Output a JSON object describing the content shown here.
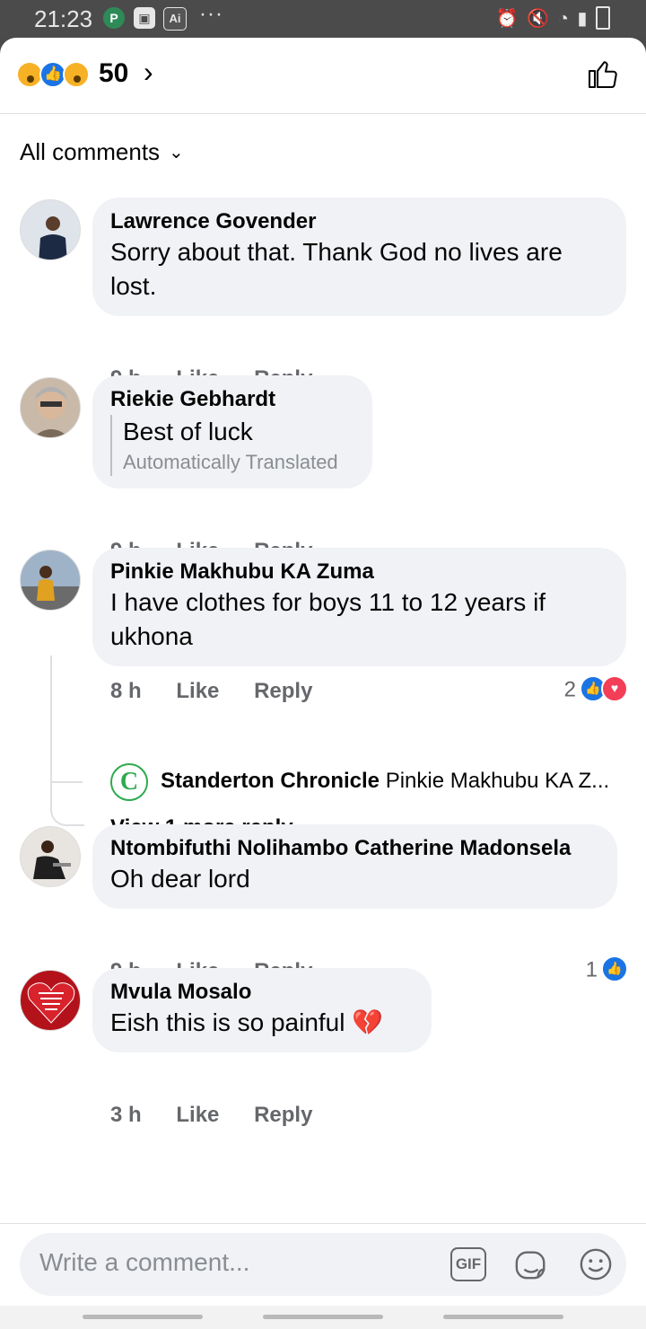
{
  "status": {
    "time": "21:23",
    "icons": [
      "p-icon",
      "image-icon",
      "ai-icon",
      "alarm-icon",
      "mute-icon",
      "wifi-icon",
      "signal-icon",
      "battery-icon"
    ],
    "battery": "7"
  },
  "header": {
    "reaction_count": "50",
    "reactions": [
      "sad",
      "like",
      "wow"
    ]
  },
  "sort": {
    "label": "All comments"
  },
  "comments": [
    {
      "author": "Lawrence Govender",
      "text": "Sorry about that. Thank God no lives are lost.",
      "age": "9 h",
      "like": "Like",
      "reply": "Reply"
    },
    {
      "author": "Riekie Gebhardt",
      "text": "Best of luck",
      "note": "Automatically Translated",
      "age": "9 h",
      "like": "Like",
      "reply": "Reply"
    },
    {
      "author": "Pinkie Makhubu KA Zuma",
      "text": "I have clothes for boys 11 to 12 years if ukhona",
      "age": "8 h",
      "like": "Like",
      "reply": "Reply",
      "reaction_count": "2"
    },
    {
      "author": "Ntombifuthi Nolihambo Catherine Madonsela",
      "text": "Oh dear lord",
      "age": "9 h",
      "like": "Like",
      "reply": "Reply",
      "reaction_count": "1"
    },
    {
      "author": "Mvula Mosalo",
      "text": "Eish this is so painful",
      "age": "3 h",
      "like": "Like",
      "reply": "Reply"
    }
  ],
  "reply_preview": {
    "author": "Standerton Chronicle",
    "text": "Pinkie Makhubu KA Z..."
  },
  "view_more": "View 1 more reply...",
  "avatar_text": "A relationship with God is the best relationship you can have!",
  "composer": {
    "placeholder": "Write a comment...",
    "gif": "GIF"
  },
  "colors": {
    "accent": "#1b74e4",
    "bubble": "#f0f2f5",
    "muted": "#65676b"
  }
}
